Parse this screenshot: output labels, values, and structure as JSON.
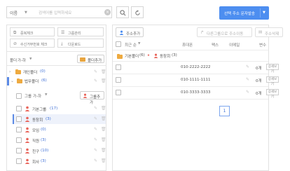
{
  "search": {
    "select_value": "이름",
    "placeholder": "검색어를 입력하세요",
    "search_button": "search-icon",
    "reset_button": "refresh-icon"
  },
  "send_button": {
    "label": "선택 주소 문자발송"
  },
  "left": {
    "buttons": [
      {
        "label": "중복체크",
        "icon": "copy-icon"
      },
      {
        "label": "그룹관리",
        "icon": "group-icon"
      },
      {
        "label": "수신거부번호 체크",
        "icon": "block-icon"
      },
      {
        "label": "다운로드",
        "icon": "download-icon"
      }
    ],
    "folder_sort": "폴더",
    "folder_sort_order": "가-하",
    "folder_add": "폴더추가",
    "folders": [
      {
        "name": "개인폴더",
        "count": "(0)"
      },
      {
        "name": "법무폴더",
        "count": "(6)"
      }
    ],
    "group_sort": "그룹",
    "group_sort_order": "가-하",
    "group_add": "그룹추가",
    "groups": [
      {
        "name": "기본그룹",
        "count": "(17)"
      },
      {
        "name": "동창회",
        "count": "(3)"
      },
      {
        "name": "모임",
        "count": "(0)"
      },
      {
        "name": "직원",
        "count": "(3)"
      },
      {
        "name": "친구",
        "count": "(10)"
      },
      {
        "name": "회사",
        "count": "(3)"
      }
    ]
  },
  "right": {
    "add_address": "주소추가",
    "move_group": "다른그룹으로 주소이동",
    "delete_address": "주소삭제",
    "columns": {
      "sort": "최근 순",
      "phone": "휴대폰",
      "fax": "팩스",
      "email": "이메일",
      "vars": "변수"
    },
    "breadcrumb": {
      "folder": "기본폴더",
      "folder_count": "(6)",
      "group": "동창회",
      "group_count": "(3)"
    },
    "rows": [
      {
        "phone": "010-2222-2222",
        "vars": "0개",
        "detail": "상세보기"
      },
      {
        "phone": "010-1111-1111",
        "vars": "0개",
        "detail": "상세보기"
      },
      {
        "phone": "010-3333-3333",
        "vars": "0개",
        "detail": "상세보기"
      }
    ],
    "page": "1"
  }
}
